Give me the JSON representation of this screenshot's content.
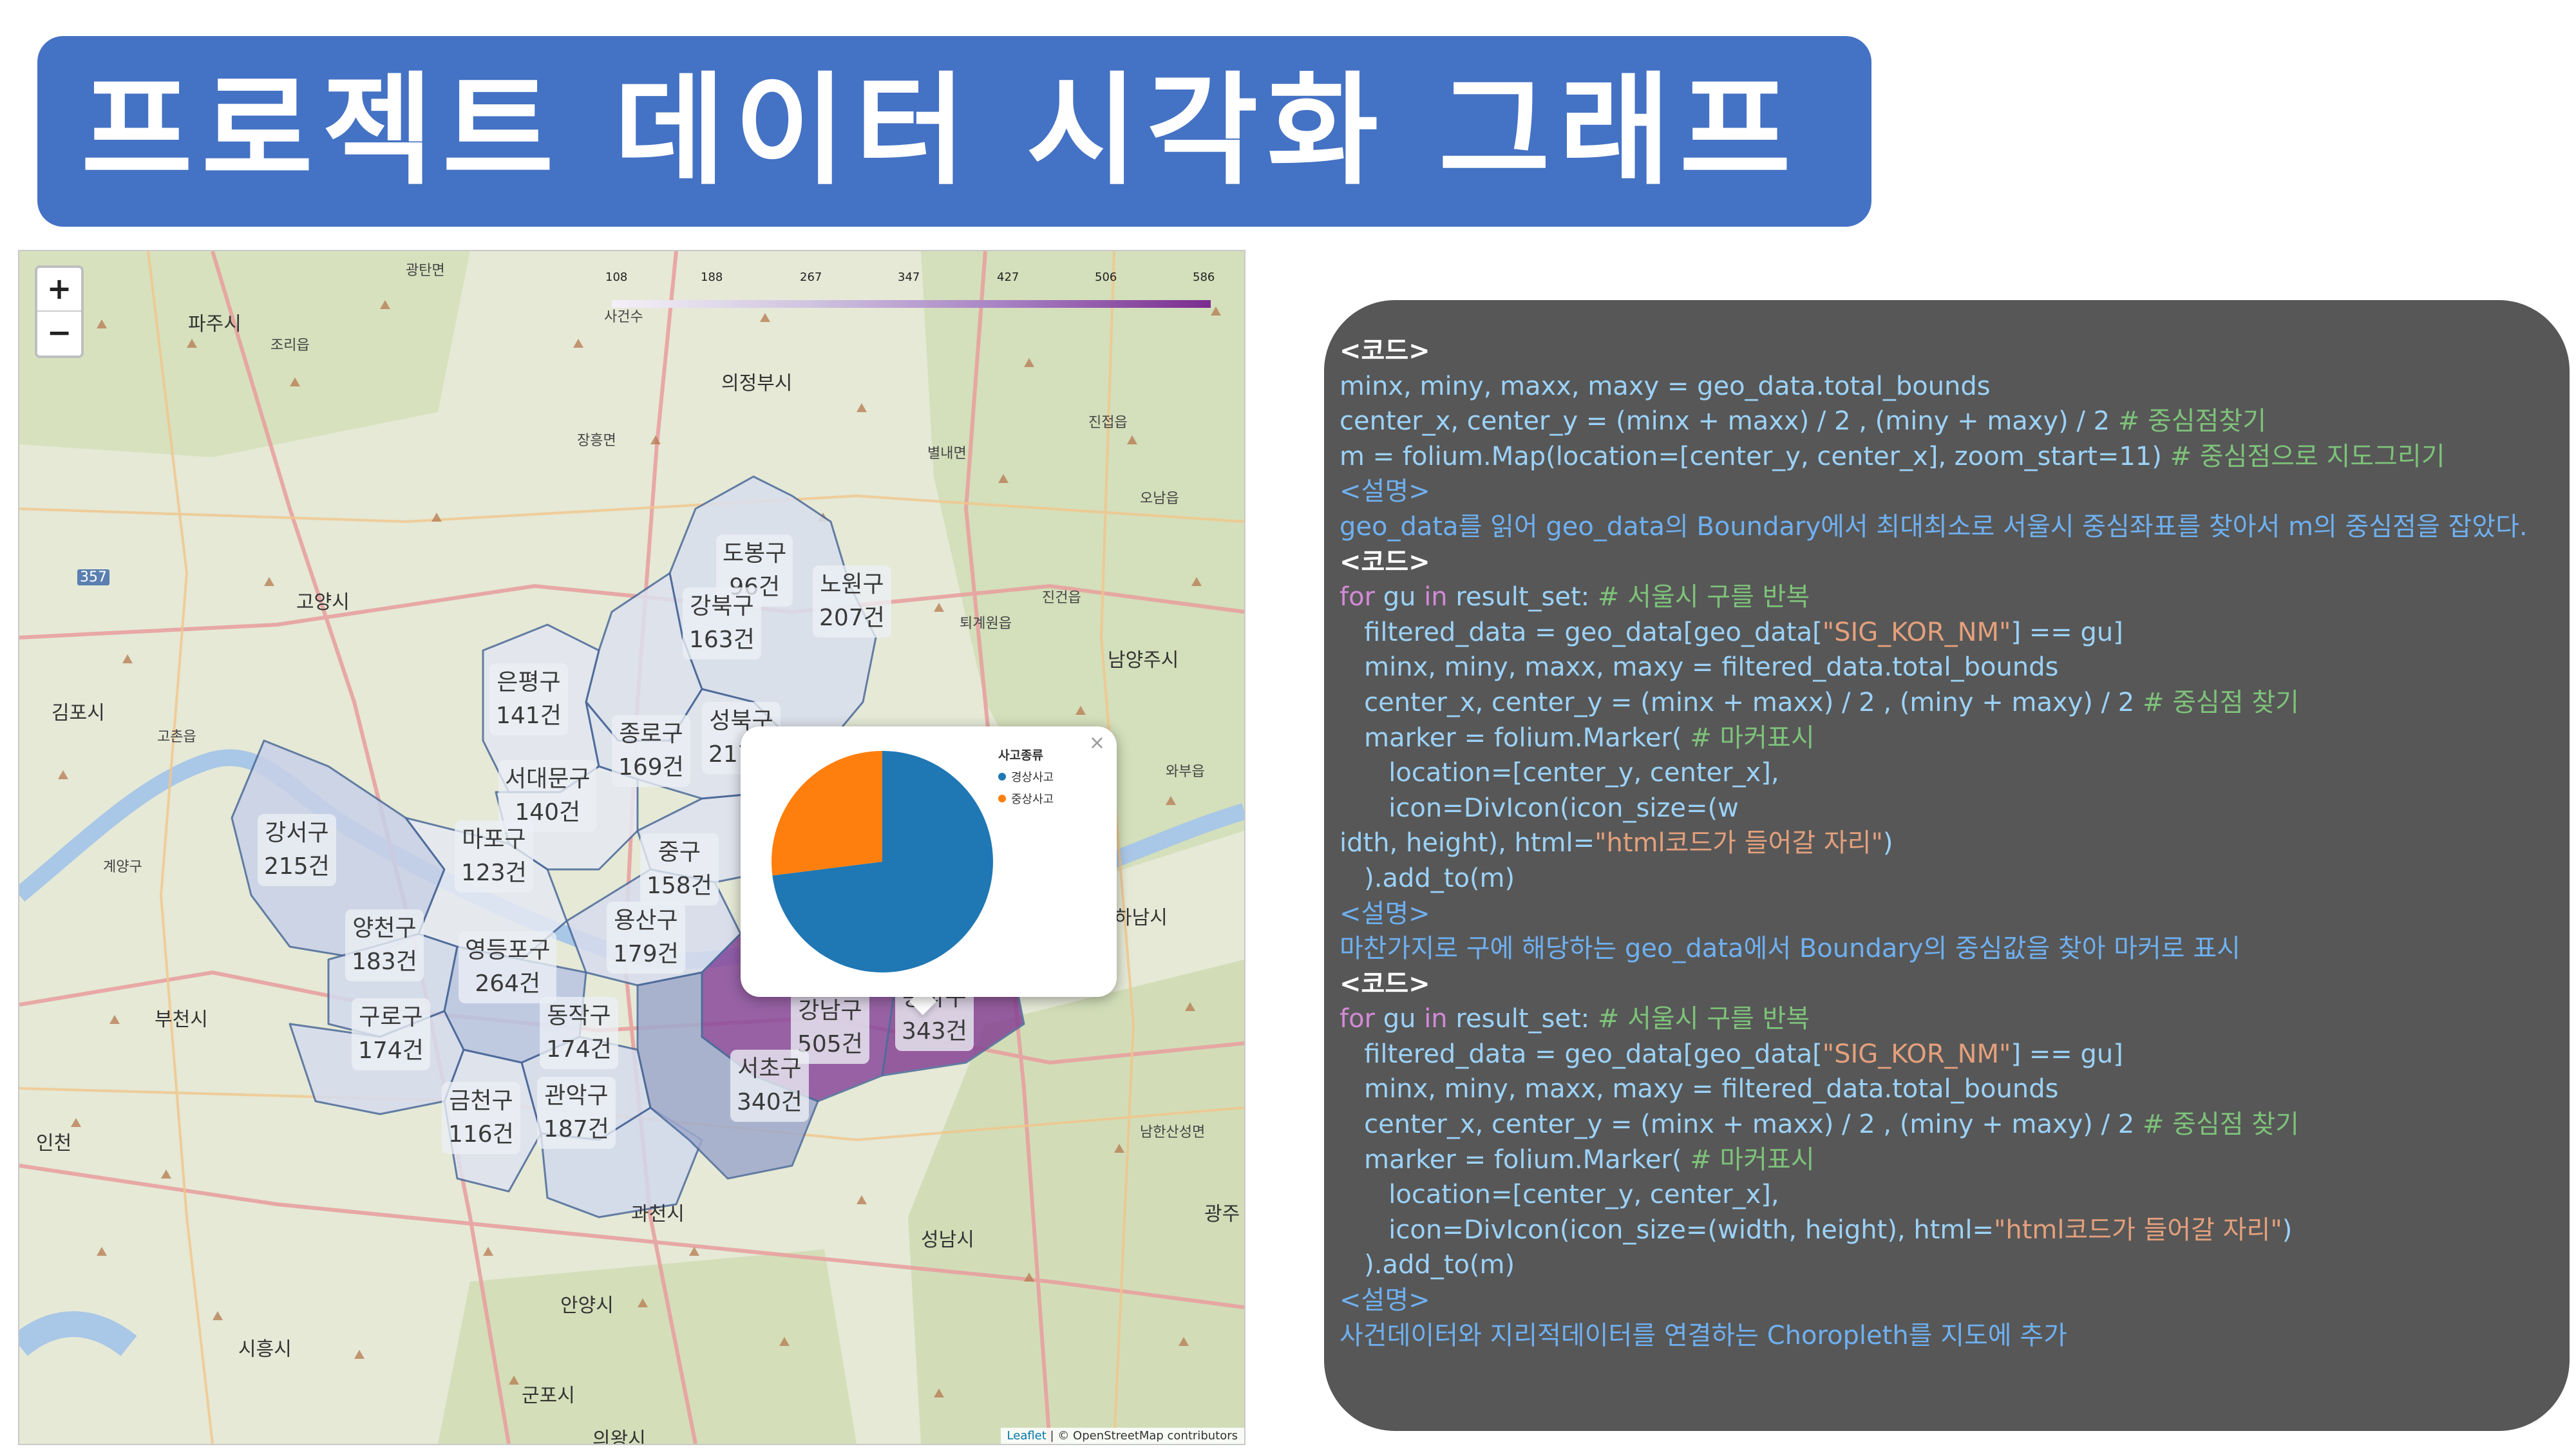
{
  "title": "프로젝트 데이터 시각화 그래프",
  "map": {
    "zoom_in": "+",
    "zoom_out": "−",
    "legend_ticks": [
      "108",
      "188",
      "267",
      "347",
      "427",
      "506",
      "586"
    ],
    "attribution_leaflet": "Leaflet",
    "attribution_rest": " | © OpenStreetMap contributors",
    "place_labels": [
      {
        "id": "paju",
        "text": "파주시"
      },
      {
        "id": "uijeongbu",
        "text": "의정부시"
      },
      {
        "id": "goyang",
        "text": "고양시"
      },
      {
        "id": "gimpo",
        "text": "김포시"
      },
      {
        "id": "namyangju",
        "text": "남양주시"
      },
      {
        "id": "bucheon",
        "text": "부천시"
      },
      {
        "id": "incheon",
        "text": "인천"
      },
      {
        "id": "hanam",
        "text": "하남시"
      },
      {
        "id": "gwacheon",
        "text": "과천시"
      },
      {
        "id": "anyang",
        "text": "안양시"
      },
      {
        "id": "seongnam",
        "text": "성남시"
      },
      {
        "id": "siheung",
        "text": "시흥시"
      },
      {
        "id": "gunpo",
        "text": "군포시"
      },
      {
        "id": "gwangju",
        "text": "광주"
      },
      {
        "id": "uiwang",
        "text": "의왕시"
      }
    ],
    "small_labels": [
      {
        "id": "gwangtanmyeon",
        "text": "광탄면"
      },
      {
        "id": "joriup",
        "text": "조리읍"
      },
      {
        "id": "sageomdong",
        "text": "사건수"
      },
      {
        "id": "jangheung",
        "text": "장흥면"
      },
      {
        "id": "byeollae",
        "text": "별내면"
      },
      {
        "id": "jinjeop",
        "text": "진접읍"
      },
      {
        "id": "onam",
        "text": "오남읍"
      },
      {
        "id": "jingeon",
        "text": "진건읍"
      },
      {
        "id": "toegyewon",
        "text": "퇴계원읍"
      },
      {
        "id": "waebu",
        "text": "와부읍"
      },
      {
        "id": "gochon",
        "text": "고촌읍"
      },
      {
        "id": "gyeyang",
        "text": "계양구"
      },
      {
        "id": "namhansanseong",
        "text": "남한산성면"
      },
      {
        "id": "road357",
        "text": "357"
      }
    ],
    "districts": [
      {
        "name": "도봉구",
        "count": "96건"
      },
      {
        "name": "노원구",
        "count": "207건"
      },
      {
        "name": "강북구",
        "count": "163건"
      },
      {
        "name": "은평구",
        "count": "141건"
      },
      {
        "name": "종로구",
        "count": "169건"
      },
      {
        "name": "성북구",
        "count": "217건"
      },
      {
        "name": "서대문구",
        "count": "140건"
      },
      {
        "name": "강서구",
        "count": "215건"
      },
      {
        "name": "마포구",
        "count": "123건"
      },
      {
        "name": "중구",
        "count": "158건"
      },
      {
        "name": "용산구",
        "count": "179건"
      },
      {
        "name": "양천구",
        "count": "183건"
      },
      {
        "name": "영등포구",
        "count": "264건"
      },
      {
        "name": "구로구",
        "count": "174건"
      },
      {
        "name": "동작구",
        "count": "174건"
      },
      {
        "name": "강남구",
        "count": "505건"
      },
      {
        "name": "송파구",
        "count": "343건"
      },
      {
        "name": "서초구",
        "count": "340건"
      },
      {
        "name": "금천구",
        "count": "116건"
      },
      {
        "name": "관악구",
        "count": "187건"
      }
    ],
    "popup": {
      "close": "×",
      "legend_title": "사고종류",
      "legend_items": [
        {
          "label": "경상사고",
          "color": "#1f77b4"
        },
        {
          "label": "중상사고",
          "color": "#ff7f0e"
        }
      ]
    }
  },
  "chart_data": {
    "type": "pie",
    "title": "",
    "legend_title": "사고종류",
    "series": [
      {
        "name": "경상사고",
        "value": 73,
        "color": "#1f77b4"
      },
      {
        "name": "중상사고",
        "value": 27,
        "color": "#ff7f0e"
      }
    ]
  },
  "code": {
    "lines": [
      [
        {
          "t": "<코드>",
          "c": "white"
        }
      ],
      [
        {
          "t": "minx, miny, maxx, maxy = geo_data.total_bounds",
          "c": "blue"
        }
      ],
      [
        {
          "t": "center_x, center_y = (minx + maxx) / 2 , (miny + maxy) / 2 ",
          "c": "blue"
        },
        {
          "t": "# 중심점찾기",
          "c": "comment"
        }
      ],
      [
        {
          "t": "m = folium.Map(location=[center_y, center_x], zoom_start=11) ",
          "c": "blue"
        },
        {
          "t": "# 중심점으로 지도그리기",
          "c": "comment"
        }
      ],
      [
        {
          "t": "<설명>",
          "c": "desc"
        }
      ],
      [
        {
          "t": "geo_data를 읽어 geo_data의 Boundary에서 최대최소로 서울시 중심좌표를 찾아서 m의 중심점을 잡았다.",
          "c": "desc"
        }
      ],
      [
        {
          "t": "<코드>",
          "c": "white"
        }
      ],
      [
        {
          "t": "for ",
          "c": "kw"
        },
        {
          "t": "gu ",
          "c": "blue"
        },
        {
          "t": "in ",
          "c": "kw"
        },
        {
          "t": "result_set: ",
          "c": "blue"
        },
        {
          "t": "# 서울시 구를 반복",
          "c": "comment"
        }
      ],
      [
        {
          "t": "   filtered_data = geo_data[geo_data[",
          "c": "blue"
        },
        {
          "t": "\"SIG_KOR_NM\"",
          "c": "str"
        },
        {
          "t": "] == gu]",
          "c": "blue"
        }
      ],
      [
        {
          "t": "   minx, miny, maxx, maxy = filtered_data.total_bounds",
          "c": "blue"
        }
      ],
      [
        {
          "t": "   center_x, center_y = (minx + maxx) / 2 , (miny + maxy) / 2 ",
          "c": "blue"
        },
        {
          "t": "# 중심점 찾기",
          "c": "comment"
        }
      ],
      [
        {
          "t": "   marker = folium.Marker( ",
          "c": "blue"
        },
        {
          "t": "# 마커표시",
          "c": "comment"
        }
      ],
      [
        {
          "t": "      location=[center_y, center_x],",
          "c": "blue"
        }
      ],
      [
        {
          "t": "      icon=DivIcon(icon_size=(w",
          "c": "blue"
        }
      ],
      [
        {
          "t": "idth, height), html=",
          "c": "blue"
        },
        {
          "t": "\"html코드가 들어갈 자리\"",
          "c": "str"
        },
        {
          "t": ")",
          "c": "blue"
        }
      ],
      [
        {
          "t": "   ).add_to(m)",
          "c": "blue"
        }
      ],
      [
        {
          "t": "<설명>",
          "c": "desc"
        }
      ],
      [
        {
          "t": "마찬가지로 구에 해당하는 geo_data에서 Boundary의 중심값을 찾아 마커로 표시",
          "c": "desc"
        }
      ],
      [
        {
          "t": "<코드>",
          "c": "white"
        }
      ],
      [
        {
          "t": "for ",
          "c": "kw"
        },
        {
          "t": "gu ",
          "c": "blue"
        },
        {
          "t": "in ",
          "c": "kw"
        },
        {
          "t": "result_set: ",
          "c": "blue"
        },
        {
          "t": "# 서울시 구를 반복",
          "c": "comment"
        }
      ],
      [
        {
          "t": "   filtered_data = geo_data[geo_data[",
          "c": "blue"
        },
        {
          "t": "\"SIG_KOR_NM\"",
          "c": "str"
        },
        {
          "t": "] == gu]",
          "c": "blue"
        }
      ],
      [
        {
          "t": "   minx, miny, maxx, maxy = filtered_data.total_bounds",
          "c": "blue"
        }
      ],
      [
        {
          "t": "   center_x, center_y = (minx + maxx) / 2 , (miny + maxy) / 2 ",
          "c": "blue"
        },
        {
          "t": "# 중심점 찾기",
          "c": "comment"
        }
      ],
      [
        {
          "t": "   marker = folium.Marker( ",
          "c": "blue"
        },
        {
          "t": "# 마커표시",
          "c": "comment"
        }
      ],
      [
        {
          "t": "      location=[center_y, center_x],",
          "c": "blue"
        }
      ],
      [
        {
          "t": "      icon=DivIcon(icon_size=(width, height), html=",
          "c": "blue"
        },
        {
          "t": "\"html코드가 들어갈 자리\"",
          "c": "str"
        },
        {
          "t": ")",
          "c": "blue"
        }
      ],
      [
        {
          "t": "   ).add_to(m)",
          "c": "blue"
        }
      ],
      [
        {
          "t": "<설명>",
          "c": "desc"
        }
      ],
      [
        {
          "t": "사건데이터와 지리적데이터를 연결하는 Choropleth를 지도에 추가",
          "c": "desc"
        }
      ]
    ]
  }
}
